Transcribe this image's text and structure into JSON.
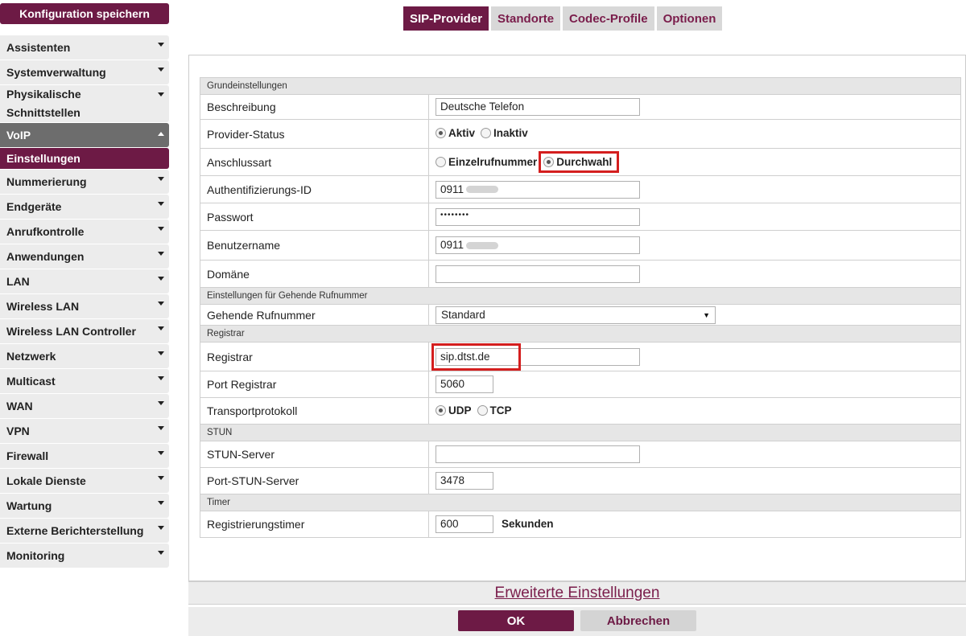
{
  "header": {
    "save_config": "Konfiguration speichern"
  },
  "sidebar": {
    "items": [
      {
        "label": "Assistenten"
      },
      {
        "label": "Systemverwaltung"
      },
      {
        "label": "Physikalische Schnittstellen"
      },
      {
        "label": "VoIP"
      },
      {
        "label": "Einstellungen"
      },
      {
        "label": "Nummerierung"
      },
      {
        "label": "Endgeräte"
      },
      {
        "label": "Anrufkontrolle"
      },
      {
        "label": "Anwendungen"
      },
      {
        "label": "LAN"
      },
      {
        "label": "Wireless LAN"
      },
      {
        "label": "Wireless LAN Controller"
      },
      {
        "label": "Netzwerk"
      },
      {
        "label": "Multicast"
      },
      {
        "label": "WAN"
      },
      {
        "label": "VPN"
      },
      {
        "label": "Firewall"
      },
      {
        "label": "Lokale Dienste"
      },
      {
        "label": "Wartung"
      },
      {
        "label": "Externe Berichterstellung"
      },
      {
        "label": "Monitoring"
      }
    ]
  },
  "tabs": [
    "SIP-Provider",
    "Standorte",
    "Codec-Profile",
    "Optionen"
  ],
  "form": {
    "section_basic": "Grundeinstellungen",
    "beschreibung": {
      "label": "Beschreibung",
      "value": "Deutsche Telefon"
    },
    "provider_status": {
      "label": "Provider-Status",
      "opt1": "Aktiv",
      "opt2": "Inaktiv"
    },
    "anschlussart": {
      "label": "Anschlussart",
      "opt1": "Einzelrufnummer",
      "opt2": "Durchwahl"
    },
    "auth_id": {
      "label": "Authentifizierungs-ID",
      "value": "0911"
    },
    "passwort": {
      "label": "Passwort",
      "value": "••••••••"
    },
    "benutzername": {
      "label": "Benutzername",
      "value": "0911"
    },
    "domaene": {
      "label": "Domäne",
      "value": ""
    },
    "section_outgoing": "Einstellungen für Gehende Rufnummer",
    "gehende": {
      "label": "Gehende Rufnummer",
      "value": "Standard"
    },
    "section_registrar": "Registrar",
    "registrar": {
      "label": "Registrar",
      "value": "sip.dtst.de"
    },
    "port_registrar": {
      "label": "Port Registrar",
      "value": "5060"
    },
    "transport": {
      "label": "Transportprotokoll",
      "opt1": "UDP",
      "opt2": "TCP"
    },
    "section_stun": "STUN",
    "stun_server": {
      "label": "STUN-Server",
      "value": ""
    },
    "port_stun": {
      "label": "Port-STUN-Server",
      "value": "3478"
    },
    "section_timer": "Timer",
    "reg_timer": {
      "label": "Registrierungstimer",
      "value": "600",
      "unit": "Sekunden"
    }
  },
  "footer": {
    "advanced": "Erweiterte Einstellungen",
    "ok": "OK",
    "cancel": "Abbrechen"
  },
  "colors": {
    "accent": "#6d1a45",
    "highlight": "#d41e1e"
  }
}
